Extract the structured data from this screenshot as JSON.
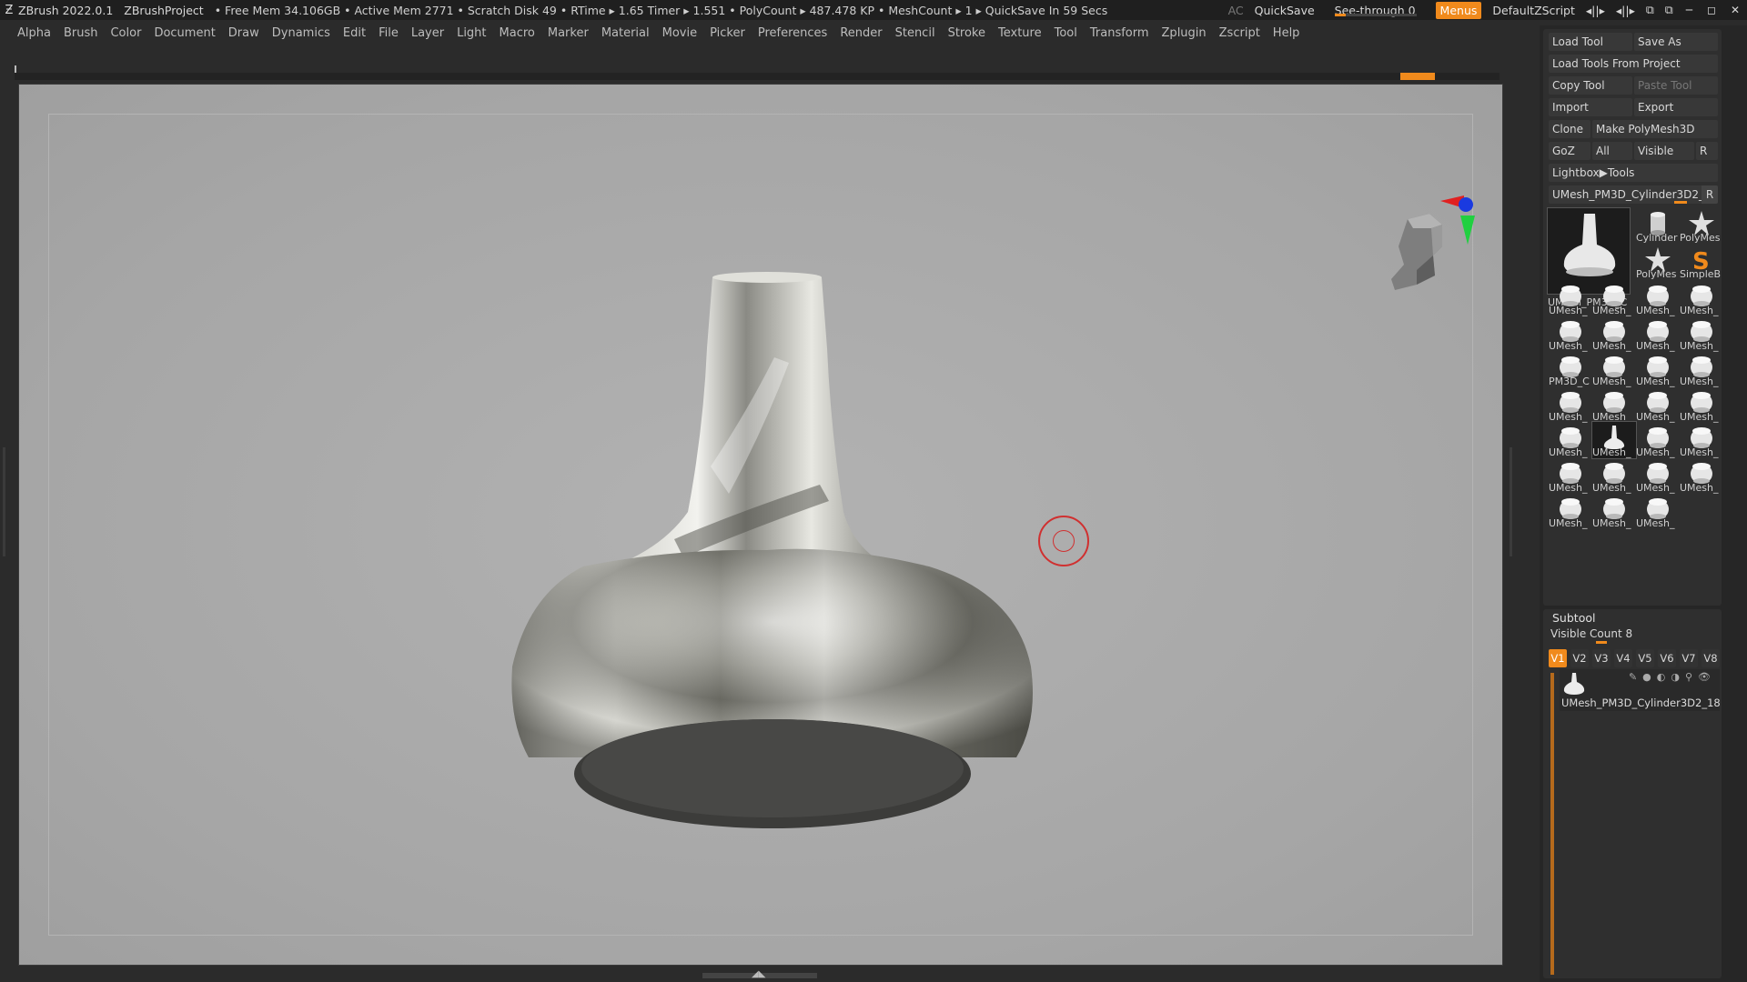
{
  "titlebar": {
    "app": "ZBrush 2022.0.1",
    "project": "ZBrushProject",
    "stats": "• Free Mem 34.106GB • Active Mem 2771 • Scratch Disk 49 •  RTime ▸ 1.65 Timer ▸ 1.551 • PolyCount ▸ 487.478 KP  • MeshCount ▸ 1  ▸ QuickSave In 59 Secs",
    "ac": "AC",
    "quicksave": "QuickSave",
    "seethrough": "See-through  0",
    "menus": "Menus",
    "zscript": "DefaultZScript",
    "icons": [
      "layout-icon",
      "layout-icon",
      "window-icon",
      "window-icon"
    ],
    "win_min": "─",
    "win_max": "◻",
    "win_close": "✕"
  },
  "menu": [
    "Alpha",
    "Brush",
    "Color",
    "Document",
    "Draw",
    "Dynamics",
    "Edit",
    "File",
    "Layer",
    "Light",
    "Macro",
    "Marker",
    "Material",
    "Movie",
    "Picker",
    "Preferences",
    "Render",
    "Stencil",
    "Stroke",
    "Texture",
    "Tool",
    "Transform",
    "Zplugin",
    "Zscript",
    "Help"
  ],
  "tool": {
    "load_tool": "Load Tool",
    "save_as": "Save As",
    "load_from_project": "Load Tools From Project",
    "copy_tool": "Copy Tool",
    "paste_tool": "Paste Tool",
    "import": "Import",
    "export": "Export",
    "clone": "Clone",
    "make_polymesh": "Make PolyMesh3D",
    "goz": "GoZ",
    "all": "All",
    "visible": "Visible",
    "r": "R",
    "lightbox": "Lightbox▶Tools",
    "current_tool": "UMesh_PM3D_Cylinder3D2_1",
    "big_thumb_label": "UMesh_PM3D_C",
    "thumbs": [
      {
        "label": "Cylinder",
        "icon": "cylinder-icon"
      },
      {
        "label": "PolyMes",
        "icon": "star-icon"
      },
      {
        "label": "PolyMes",
        "icon": "star-icon"
      },
      {
        "label": "SimpleB",
        "icon": "simple-brush-icon"
      },
      {
        "label": "UMesh_",
        "icon": "mesh-icon"
      },
      {
        "label": "UMesh_",
        "icon": "mesh-icon"
      },
      {
        "label": "UMesh_",
        "icon": "mesh-icon"
      },
      {
        "label": "UMesh_",
        "icon": "mesh-icon"
      },
      {
        "label": "UMesh_",
        "icon": "mesh-icon"
      },
      {
        "label": "UMesh_",
        "icon": "mesh-icon"
      },
      {
        "label": "UMesh_",
        "icon": "mesh-icon"
      },
      {
        "label": "UMesh_",
        "icon": "mesh-icon"
      },
      {
        "label": "PM3D_C",
        "icon": "mesh-icon"
      },
      {
        "label": "UMesh_",
        "icon": "mesh-icon"
      },
      {
        "label": "UMesh_",
        "icon": "mesh-icon"
      },
      {
        "label": "UMesh_",
        "icon": "mesh-icon"
      },
      {
        "label": "UMesh_",
        "icon": "mesh-icon"
      },
      {
        "label": "UMesh_",
        "icon": "mesh-icon"
      },
      {
        "label": "UMesh_",
        "icon": "mesh-icon"
      },
      {
        "label": "UMesh_",
        "icon": "mesh-icon"
      },
      {
        "label": "UMesh_",
        "icon": "mesh-icon"
      },
      {
        "label": "UMesh_",
        "icon": "vase-icon"
      },
      {
        "label": "UMesh_",
        "icon": "mesh-icon"
      },
      {
        "label": "UMesh_",
        "icon": "mesh-icon"
      },
      {
        "label": "UMesh_",
        "icon": "mesh-icon"
      },
      {
        "label": "UMesh_",
        "icon": "mesh-icon"
      },
      {
        "label": "UMesh_",
        "icon": "mesh-icon"
      },
      {
        "label": "UMesh_",
        "icon": "mesh-icon"
      },
      {
        "label": "UMesh_",
        "icon": "mesh-icon"
      },
      {
        "label": "UMesh_",
        "icon": "mesh-icon"
      },
      {
        "label": "UMesh_",
        "icon": "mesh-icon"
      }
    ]
  },
  "subtool": {
    "title": "Subtool",
    "visible_count": "Visible Count 8",
    "tabs": [
      "V1",
      "V2",
      "V3",
      "V4",
      "V5",
      "V6",
      "V7",
      "V8"
    ],
    "active_tab": "V1",
    "item": "UMesh_PM3D_Cylinder3D2_18"
  },
  "colors": {
    "accent": "#f08a1c",
    "canvas": "#a9a9a9",
    "panel": "#2f2f2f"
  },
  "scene": {
    "object": "vase",
    "navigator": "head-icon",
    "cursor": "brush-cursor-icon"
  }
}
